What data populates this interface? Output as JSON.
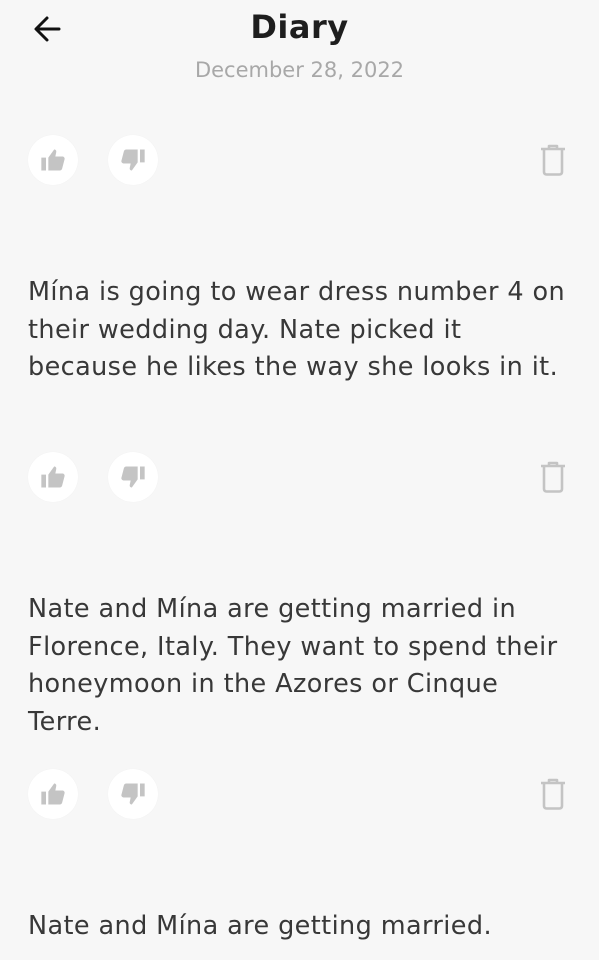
{
  "header": {
    "title": "Diary",
    "date": "December 28, 2022",
    "back_icon": "arrow-left-icon"
  },
  "icons": {
    "like": "thumbs-up-icon",
    "dislike": "thumbs-down-icon",
    "delete": "trash-icon"
  },
  "colors": {
    "background": "#f7f7f7",
    "icon": "#c4c4c4",
    "text": "#383838",
    "subtitle": "#a8a8a8"
  },
  "entries": [
    {
      "text": "Mína is going to wear dress number 4 on their wedding day. Nate picked it because he likes the way she looks in it."
    },
    {
      "text": "Nate and Mína are getting married in Florence, Italy. They want to spend their honeymoon in the Azores or Cinque Terre."
    },
    {
      "text": "Nate and Mína are getting married."
    }
  ]
}
